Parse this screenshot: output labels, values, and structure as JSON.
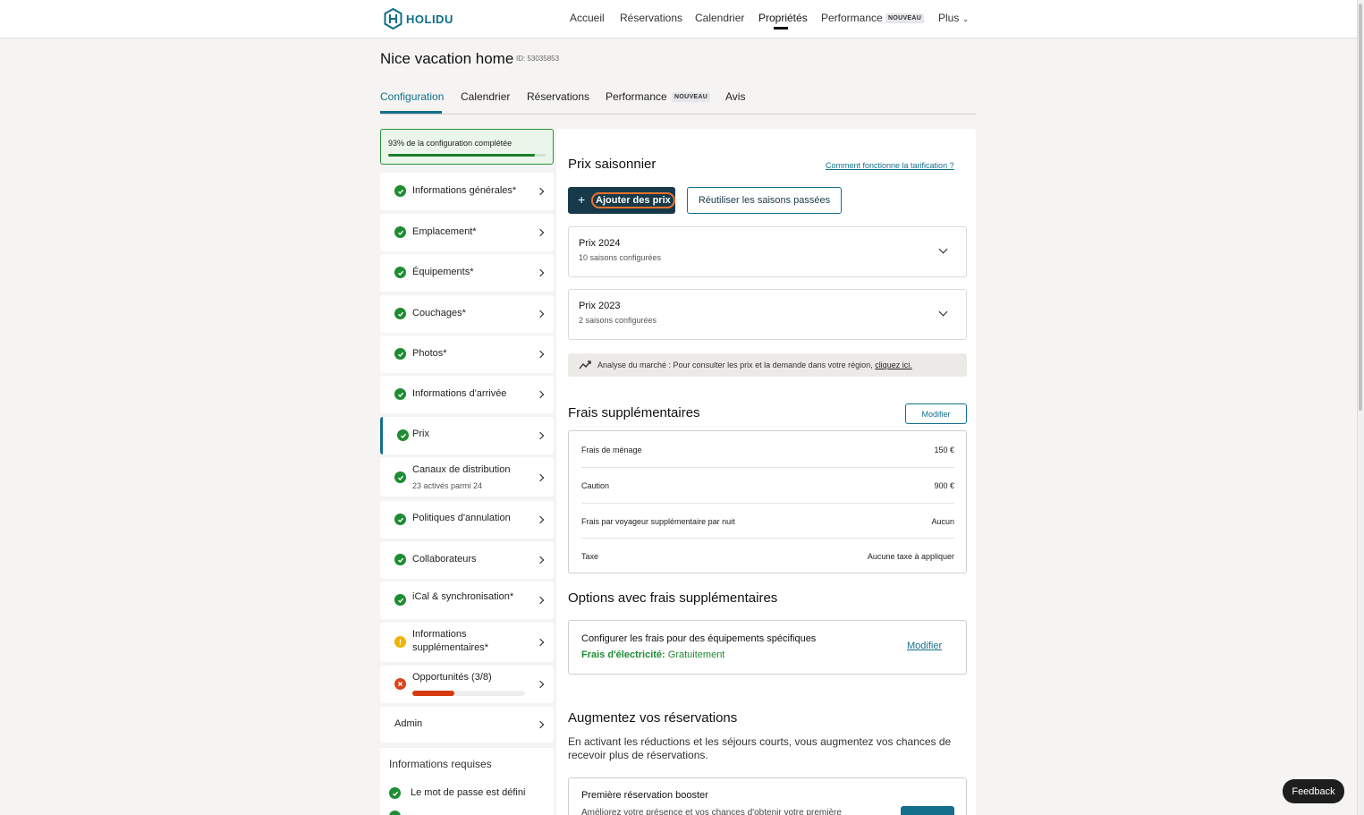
{
  "brand": {
    "name": "HOLIDU",
    "color": "#0c6f8a"
  },
  "topnav": {
    "items": [
      "Accueil",
      "Réservations",
      "Calendrier",
      "Propriétés",
      "Performance",
      "Plus"
    ],
    "new_badge": "NOUVEAU",
    "active": "Propriétés"
  },
  "property": {
    "title": "Nice vacation home",
    "id_label": "ID: 53035853"
  },
  "tabs": {
    "items": [
      "Configuration",
      "Calendrier",
      "Réservations",
      "Performance",
      "Avis"
    ],
    "new_badge": "NOUVEAU",
    "active": "Configuration"
  },
  "setup_progress": {
    "label": "93% de la configuration complétée",
    "percent": 93
  },
  "sidebar": {
    "items": [
      {
        "label": "Informations générales*",
        "status": "ok"
      },
      {
        "label": "Emplacement*",
        "status": "ok"
      },
      {
        "label": "Équipements*",
        "status": "ok"
      },
      {
        "label": "Couchages*",
        "status": "ok"
      },
      {
        "label": "Photos*",
        "status": "ok"
      },
      {
        "label": "Informations d'arrivée",
        "status": "ok"
      },
      {
        "label": "Prix",
        "status": "ok",
        "active": true
      },
      {
        "label": "Canaux de distribution",
        "sub": "23 activés parmi 24",
        "status": "ok"
      },
      {
        "label": "Politiques d'annulation",
        "status": "ok"
      },
      {
        "label": "Collaborateurs",
        "status": "ok"
      },
      {
        "label": "iCal & synchronisation*",
        "status": "ok"
      },
      {
        "label": "Informations supplémentaires*",
        "label_line1": "Informations",
        "label_line2": "supplémentaires*",
        "status": "warn"
      },
      {
        "label": "Opportunités (3/8)",
        "status": "err",
        "progress": 0.375
      },
      {
        "label": "Admin"
      }
    ]
  },
  "required_info": {
    "title": "Informations requises",
    "items": [
      "Le mot de passe est défini"
    ]
  },
  "seasonal_prices": {
    "title": "Prix saisonnier",
    "help_link": "Comment fonctionne la tarification ?",
    "add_button": "Ajouter des prix",
    "reuse_button": "Réutiliser les saisons passées",
    "groups": [
      {
        "title": "Prix 2024",
        "sub": "10 saisons configurées"
      },
      {
        "title": "Prix 2023",
        "sub": "2 saisons configurées"
      }
    ],
    "market_text": "Analyse du marché : Pour consulter les prix et la demande dans votre région,",
    "market_link": "cliquez ici."
  },
  "extra_fees": {
    "title": "Frais supplémentaires",
    "edit_button": "Modifier",
    "rows": [
      {
        "label": "Frais de ménage",
        "value": "150 €"
      },
      {
        "label": "Caution",
        "value": "900 €"
      },
      {
        "label": "Frais par voyageur supplémentaire par nuit",
        "value": "Aucun"
      },
      {
        "label": "Taxe",
        "value": "Aucune taxe à appliquer"
      }
    ]
  },
  "options": {
    "title": "Options avec frais supplémentaires",
    "card_title": "Configurer les frais pour des équipements spécifiques",
    "fee_label": "Frais d'électricité:",
    "fee_value": "Gratuitement",
    "edit_link": "Modifier"
  },
  "boost": {
    "title": "Augmentez vos réservations",
    "desc": "En activant les réductions et les séjours courts, vous augmentez vos chances de recevoir plus de réservations.",
    "card_title": "Première réservation booster",
    "card_sub": "Améliorez votre présence et vos chances d'obtenir votre première"
  },
  "feedback_button": "Feedback",
  "colors": {
    "accent": "#136f8c",
    "success": "#1e8c32",
    "warning": "#f0b400",
    "error": "#d9451d",
    "dark_button": "#173a4a"
  }
}
